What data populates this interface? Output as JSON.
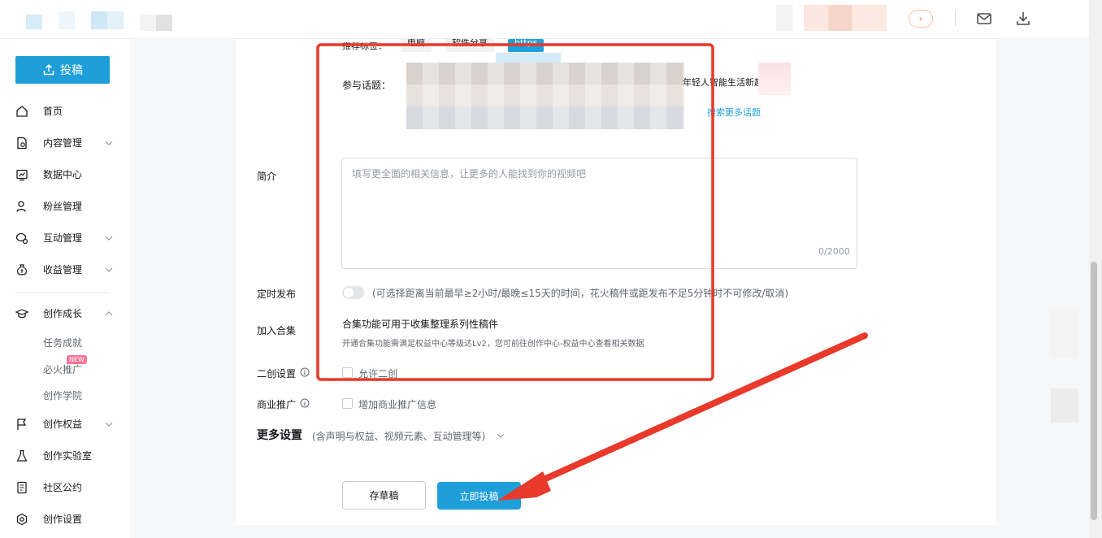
{
  "header": {
    "mail_icon": "mail-icon",
    "download_icon": "download-icon",
    "profile_chevron": "›"
  },
  "sidebar": {
    "upload_label": "投稿",
    "items": [
      {
        "label": "首页",
        "icon": "home-icon"
      },
      {
        "label": "内容管理",
        "icon": "document-icon"
      },
      {
        "label": "数据中心",
        "icon": "chart-icon"
      },
      {
        "label": "粉丝管理",
        "icon": "user-icon"
      },
      {
        "label": "互动管理",
        "icon": "chat-icon"
      },
      {
        "label": "收益管理",
        "icon": "money-bag-icon"
      },
      {
        "label": "创作成长",
        "icon": "graduation-cap-icon"
      },
      {
        "label": "创作权益",
        "icon": "flag-icon"
      },
      {
        "label": "创作实验室",
        "icon": "flask-icon"
      },
      {
        "label": "社区公约",
        "icon": "book-icon"
      },
      {
        "label": "创作设置",
        "icon": "settings-icon"
      }
    ],
    "sub_items": [
      {
        "label": "任务成就"
      },
      {
        "label": "必火推广"
      },
      {
        "label": "创作学院"
      }
    ],
    "new_badge": "NEW"
  },
  "form": {
    "recommended_tags_label": "推荐标签：",
    "tags": [
      "电脑",
      "软件分享",
      "https"
    ],
    "topics_label": "参与话题：",
    "topic_visible_text": "年轻人智能生活新趋势",
    "search_more_topics": "搜索更多话题",
    "desc_label": "简介",
    "desc_placeholder": "填写更全面的相关信息，让更多的人能找到你的视频吧",
    "desc_count": "0/2000",
    "schedule_label": "定时发布",
    "schedule_hint": "(可选择距离当前最早≥2小时/最晚≤15天的时间，花火稿件或距发布不足5分钟时不可修改/取消)",
    "collection_label": "加入合集",
    "collection_title": "合集功能可用于收集整理系列性稿件",
    "collection_note": "开通合集功能需满足权益中心等级达Lv2，您可前往创作中心-权益中心查看相关数据",
    "derivative_label": "二创设置",
    "derivative_option": "允许二创",
    "commercial_label": "商业推广",
    "commercial_option": "增加商业推广信息",
    "more_settings_title": "更多设置",
    "more_settings_sub": "(含声明与权益、视频元素、互动管理等)",
    "save_draft": "存草稿",
    "submit": "立即投稿"
  },
  "colors": {
    "accent": "#1f9fd9",
    "annotation_red": "#e8392b",
    "badge_pink": "#fb7299"
  }
}
